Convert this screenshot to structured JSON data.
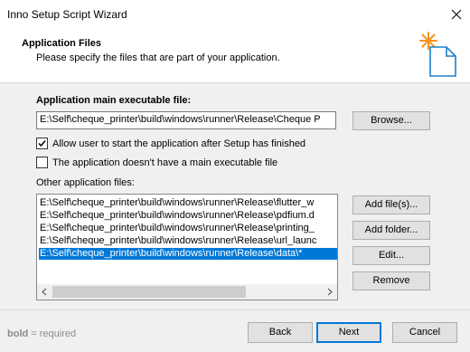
{
  "window": {
    "title": "Inno Setup Script Wizard"
  },
  "header": {
    "title": "Application Files",
    "subtitle": "Please specify the files that are part of your application."
  },
  "main_exe": {
    "label": "Application main executable file:",
    "value": "E:\\Self\\cheque_printer\\build\\windows\\runner\\Release\\Cheque P",
    "browse_label": "Browse..."
  },
  "options": {
    "allow_start_label": "Allow user to start the application after Setup has finished",
    "allow_start_checked": true,
    "no_main_exe_label": "The application doesn't have a main executable file",
    "no_main_exe_checked": false
  },
  "other_files": {
    "label": "Other application files:",
    "items": [
      "E:\\Self\\cheque_printer\\build\\windows\\runner\\Release\\flutter_w",
      "E:\\Self\\cheque_printer\\build\\windows\\runner\\Release\\pdfium.d",
      "E:\\Self\\cheque_printer\\build\\windows\\runner\\Release\\printing_",
      "E:\\Self\\cheque_printer\\build\\windows\\runner\\Release\\url_launc",
      "E:\\Self\\cheque_printer\\build\\windows\\runner\\Release\\data\\*"
    ],
    "selected_index": 4,
    "buttons": {
      "add_files": "Add file(s)...",
      "add_folder": "Add folder...",
      "edit": "Edit...",
      "remove": "Remove"
    }
  },
  "footer": {
    "legend_bold": "bold",
    "legend_rest": " = required",
    "back": "Back",
    "next": "Next",
    "cancel": "Cancel"
  },
  "colors": {
    "selection": "#0078d7",
    "icon_star": "#f7931e",
    "icon_page": "#1e7fc9"
  }
}
